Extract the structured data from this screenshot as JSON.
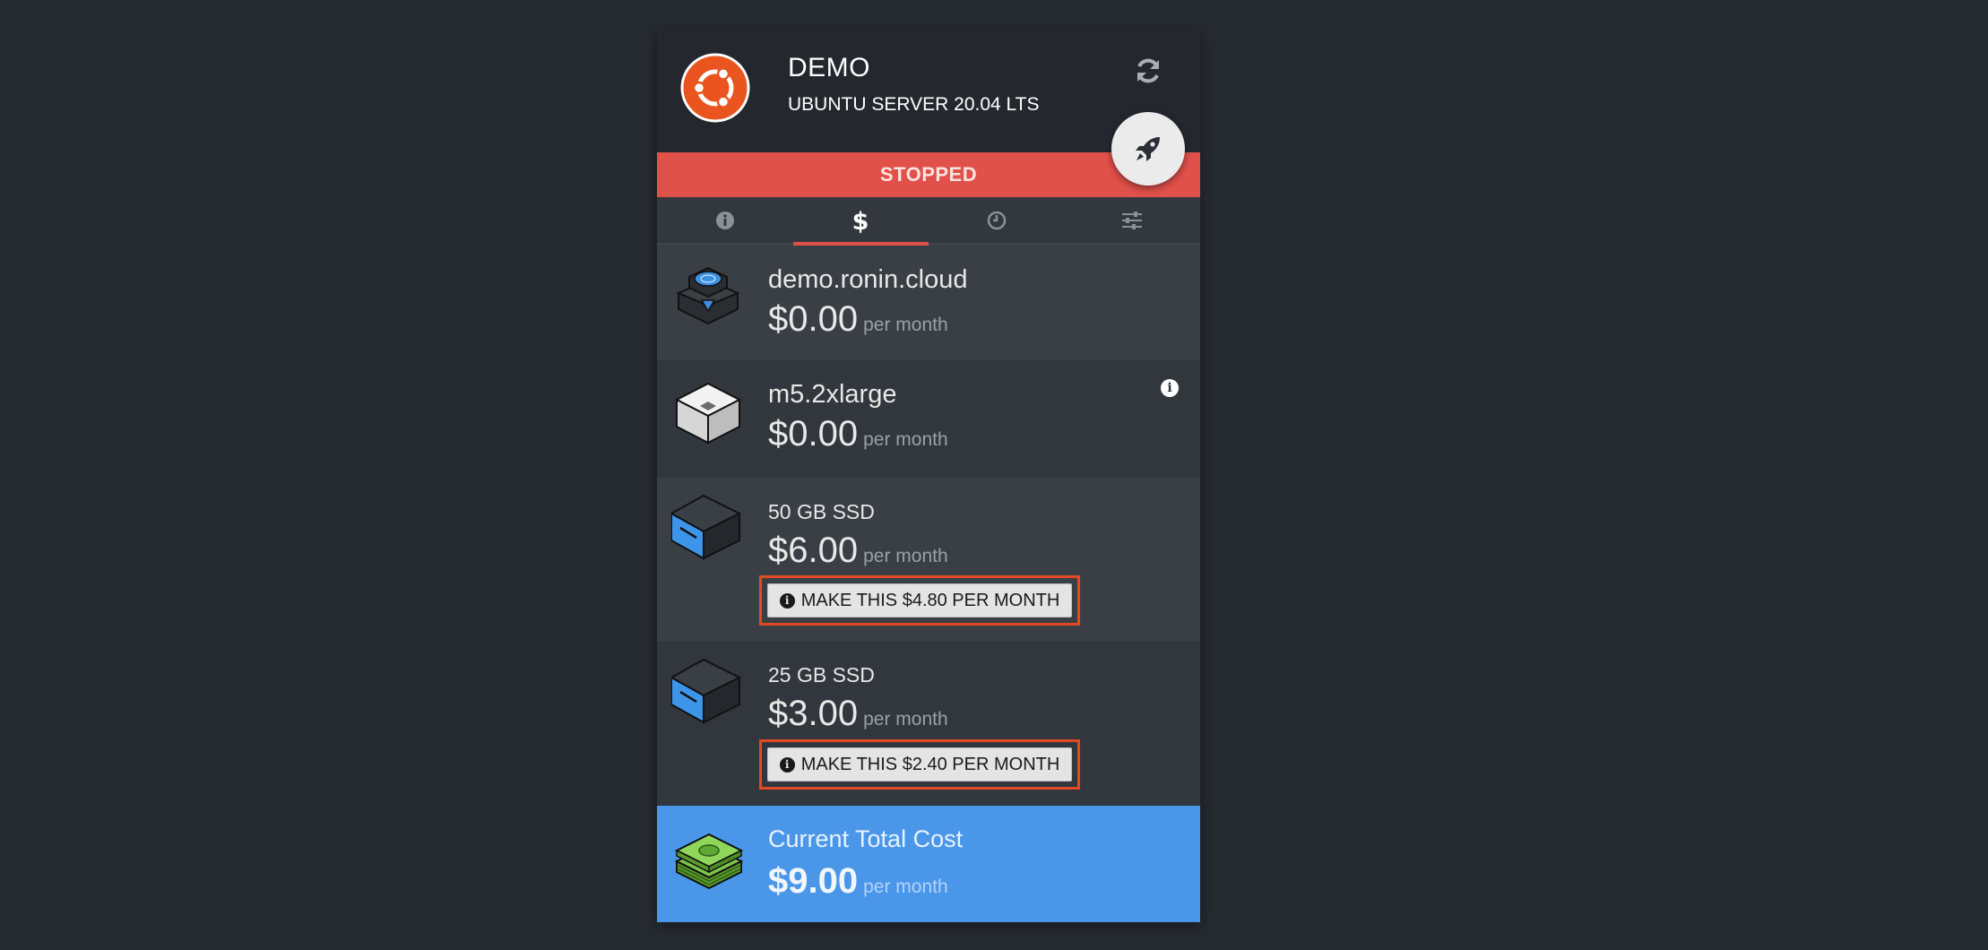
{
  "header": {
    "title": "DEMO",
    "subtitle": "UBUNTU SERVER 20.04 LTS",
    "logo_icon": "ubuntu-logo",
    "refresh_icon": "refresh-icon",
    "launch_icon": "rocket-icon"
  },
  "status": {
    "label": "STOPPED",
    "color": "#e0514a"
  },
  "tabs": [
    {
      "icon": "info-icon",
      "active": false
    },
    {
      "icon": "dollar-icon",
      "active": true
    },
    {
      "icon": "clock-icon",
      "active": false
    },
    {
      "icon": "sliders-icon",
      "active": false
    }
  ],
  "items": [
    {
      "name": "demo.ronin.cloud",
      "price": "$0.00",
      "period": "per month",
      "icon": "dns-server-icon"
    },
    {
      "name": "m5.2xlarge",
      "price": "$0.00",
      "period": "per month",
      "icon": "instance-box-icon",
      "info_icon": "info-icon"
    },
    {
      "name": "50 GB SSD",
      "price": "$6.00",
      "period": "per month",
      "icon": "ssd-drive-icon",
      "save_button": "MAKE THIS $4.80 PER MONTH"
    },
    {
      "name": "25 GB SSD",
      "price": "$3.00",
      "period": "per month",
      "icon": "ssd-drive-icon",
      "save_button": "MAKE THIS $2.40 PER MONTH"
    }
  ],
  "total": {
    "label": "Current Total Cost",
    "price": "$9.00",
    "period": "per month",
    "icon": "money-stack-icon",
    "color": "#4a97ea"
  }
}
